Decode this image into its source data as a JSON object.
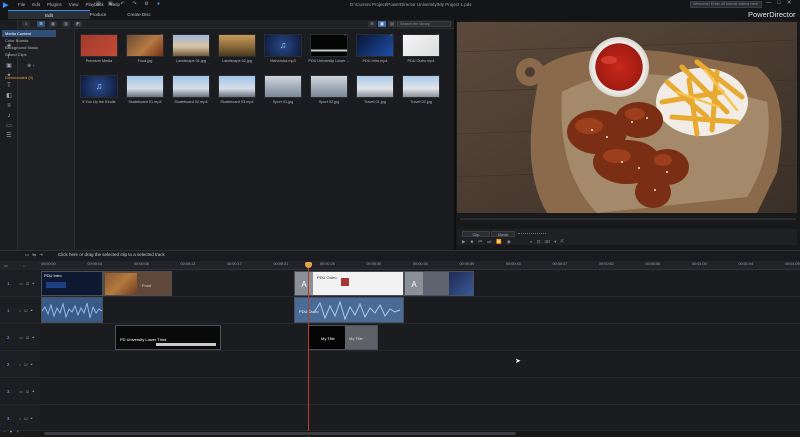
{
  "window": {
    "menu": [
      "File",
      "Edit",
      "Plugins",
      "View",
      "Playback",
      "Help"
    ],
    "project_path": "D:\\Current Project\\PowerDirector University\\My Project 1.pds",
    "search_placeholder": "Welcome! Enter all tutorial videos here",
    "controls": [
      "—",
      "□",
      "✕"
    ]
  },
  "modes": {
    "edit": "Edit",
    "produce": "Produce",
    "create_disc": "Create Disc"
  },
  "brand": "PowerDirector",
  "library": {
    "search_placeholder": "Search the library",
    "tree": {
      "media_content": "Media Content",
      "color_boards": "Color Boards",
      "background_music": "Background Music",
      "sound_clips": "Sound Clips",
      "downloaded": "Downloaded (0)"
    },
    "row1": [
      {
        "label": "Premium Media",
        "kind": "premium"
      },
      {
        "label": "Food.jpg",
        "kind": "food"
      },
      {
        "label": "Landscape 01.jpg",
        "kind": "land1"
      },
      {
        "label": "Landscape 02.jpg",
        "kind": "land2"
      },
      {
        "label": "Mahoroba.mp3",
        "kind": "music"
      },
      {
        "label": "PDU University Lower ...",
        "kind": "lower"
      },
      {
        "label": "PDU Intro.mp4",
        "kind": "intro"
      },
      {
        "label": "PDU Outro.mp4",
        "kind": "outro"
      }
    ],
    "row2": [
      {
        "label": "If You Up the Kindle",
        "kind": "music"
      },
      {
        "label": "Skateboard 01.mp4",
        "kind": "skate"
      },
      {
        "label": "Skateboard 02.mp4",
        "kind": "skate"
      },
      {
        "label": "Skateboard 03.mp4",
        "kind": "skate"
      },
      {
        "label": "Sport 01.jpg",
        "kind": "sport"
      },
      {
        "label": "Sport 02.jpg",
        "kind": "sport"
      },
      {
        "label": "Travel 01.jpg",
        "kind": "travel"
      },
      {
        "label": "Travel 02.jpg",
        "kind": "travel"
      }
    ]
  },
  "preview": {
    "clip_btn": "Clip",
    "movie_btn": "Movie",
    "mode_3d": "3D"
  },
  "timeline": {
    "hint": "Click here or drag the selected clip to a selected track",
    "ruler": [
      "00:00:00",
      "00:00:04",
      "00:00:08",
      "00:00:13",
      "00:00:17",
      "00:00:21",
      "00:00:26",
      "00:00:30",
      "00:00:34",
      "00:00:39",
      "00:00:43",
      "00:00:47",
      "00:00:52",
      "00:00:56",
      "00:01:00",
      "00:01:04",
      "00:01:09"
    ],
    "tracks": [
      "1.",
      "1.",
      "2.",
      "2.",
      "3.",
      "3."
    ],
    "clips": {
      "pdu_intro": "PDU Intro",
      "food": "Food",
      "pdu_outro": "PDU Outro",
      "pdu_intro_audio": "PDU Intro",
      "pdu_outro_audio": "PDU Outro",
      "lower_third": "PD University Lower Third",
      "my_title": "My Title",
      "my_title_tag": "My Title"
    }
  }
}
